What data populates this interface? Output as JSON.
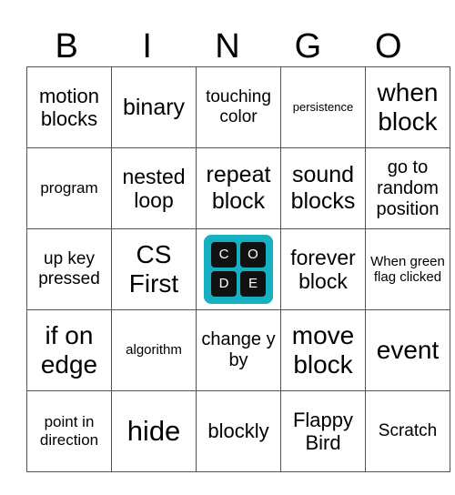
{
  "header": [
    "B",
    "I",
    "N",
    "G",
    "O"
  ],
  "free_space": {
    "icon": "code-org-logo-icon",
    "letters": [
      "C",
      "O",
      "D",
      "E"
    ],
    "color": "#17b0c2"
  },
  "rows": [
    [
      "motion blocks",
      "binary",
      "touching color",
      "persistence",
      "when block"
    ],
    [
      "program",
      "nested loop",
      "repeat block",
      "sound blocks",
      "go to random position"
    ],
    [
      "up key pressed",
      "CS First",
      "",
      "forever block",
      "When green flag clicked"
    ],
    [
      "if on edge",
      "algorithm",
      "change y by",
      "move block",
      "event"
    ],
    [
      "point in direction",
      "hide",
      "blockly",
      "Flappy Bird",
      "Scratch"
    ]
  ]
}
